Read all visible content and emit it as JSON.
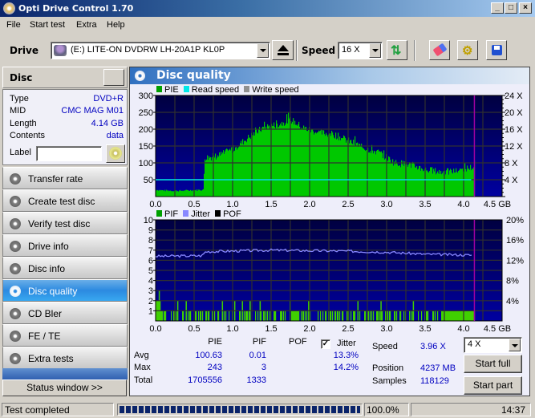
{
  "window": {
    "title": "Opti Drive Control 1.70",
    "min": "_",
    "max": "□",
    "close": "×"
  },
  "menu": [
    "File",
    "Start test",
    "Extra",
    "Help"
  ],
  "toolbar": {
    "drive_label": "Drive",
    "drive_value": "(E:)  LITE-ON DVDRW LH-20A1P KL0P",
    "speed_label": "Speed",
    "speed_value": "16 X"
  },
  "disc": {
    "header": "Disc",
    "rows": [
      {
        "key": "Type",
        "value": "DVD+R"
      },
      {
        "key": "MID",
        "value": "CMC MAG M01"
      },
      {
        "key": "Length",
        "value": "4.14 GB"
      },
      {
        "key": "Contents",
        "value": "data"
      }
    ],
    "label_key": "Label",
    "label_value": ""
  },
  "nav": [
    {
      "label": "Transfer rate",
      "active": false
    },
    {
      "label": "Create test disc",
      "active": false
    },
    {
      "label": "Verify test disc",
      "active": false
    },
    {
      "label": "Drive info",
      "active": false
    },
    {
      "label": "Disc info",
      "active": false
    },
    {
      "label": "Disc quality",
      "active": true
    },
    {
      "label": "CD Bler",
      "active": false
    },
    {
      "label": "FE / TE",
      "active": false
    },
    {
      "label": "Extra tests",
      "active": false
    }
  ],
  "status_window_button": "Status window >>",
  "main_title": "Disc quality",
  "colors": {
    "pie": "#00c800",
    "read": "#00e8e8",
    "write": "#909090",
    "pif": "#00c800",
    "jitter": "#8888ff",
    "pof": "#000000",
    "plot_bg_top": "#000040",
    "plot_bg_bottom": "#0000a0",
    "marker": "#a000a0"
  },
  "chart_data": [
    {
      "type": "bar",
      "title": "PIE / Read speed",
      "legend": [
        "PIE",
        "Read speed",
        "Write speed"
      ],
      "x_ticks": [
        "0.0",
        "0.5",
        "1.0",
        "1.5",
        "2.0",
        "2.5",
        "3.0",
        "3.5",
        "4.0",
        "4.5 GB"
      ],
      "xlim": [
        0,
        4.5
      ],
      "y_ticks": [
        "50",
        "100",
        "150",
        "200",
        "250",
        "300"
      ],
      "ylim": [
        0,
        300
      ],
      "y2_ticks": [
        "4 X",
        "8 X",
        "12 X",
        "16 X",
        "20 X",
        "24 X"
      ],
      "y2lim": [
        0,
        24
      ],
      "disc_end_gb": 4.14,
      "pie_profile": [
        [
          0.0,
          20
        ],
        [
          0.1,
          18
        ],
        [
          0.3,
          17
        ],
        [
          0.5,
          19
        ],
        [
          0.62,
          20
        ],
        [
          0.63,
          115
        ],
        [
          0.8,
          120
        ],
        [
          1.0,
          140
        ],
        [
          1.2,
          175
        ],
        [
          1.4,
          205
        ],
        [
          1.6,
          215
        ],
        [
          1.75,
          228
        ],
        [
          1.9,
          205
        ],
        [
          2.1,
          190
        ],
        [
          2.3,
          185
        ],
        [
          2.5,
          165
        ],
        [
          2.7,
          145
        ],
        [
          2.9,
          130
        ],
        [
          3.1,
          100
        ],
        [
          3.3,
          95
        ],
        [
          3.5,
          80
        ],
        [
          3.7,
          72
        ],
        [
          3.9,
          75
        ],
        [
          4.0,
          82
        ],
        [
          4.14,
          88
        ]
      ],
      "read_speed_x": 4.0
    },
    {
      "type": "bar",
      "title": "PIF / Jitter",
      "legend": [
        "PIF",
        "Jitter",
        "POF"
      ],
      "x_ticks": [
        "0.0",
        "0.5",
        "1.0",
        "1.5",
        "2.0",
        "2.5",
        "3.0",
        "3.5",
        "4.0",
        "4.5 GB"
      ],
      "xlim": [
        0,
        4.5
      ],
      "y_ticks": [
        "1",
        "2",
        "3",
        "4",
        "5",
        "6",
        "7",
        "8",
        "9",
        "10"
      ],
      "ylim": [
        0,
        10
      ],
      "y2_ticks": [
        "4%",
        "8%",
        "12%",
        "16%",
        "20%"
      ],
      "y2lim": [
        0,
        20
      ],
      "disc_end_gb": 4.14,
      "jitter_profile": [
        [
          0.0,
          12.8
        ],
        [
          0.6,
          12.9
        ],
        [
          0.65,
          13.7
        ],
        [
          1.5,
          14.0
        ],
        [
          2.0,
          13.9
        ],
        [
          2.5,
          13.8
        ],
        [
          3.0,
          13.6
        ],
        [
          3.5,
          13.2
        ],
        [
          4.14,
          13.0
        ]
      ],
      "pif_spikes_2": [
        0.02,
        0.05,
        0.28,
        0.39,
        0.86,
        1.02,
        1.12,
        1.22,
        1.35,
        1.74,
        1.98,
        2.62,
        2.92,
        3.34
      ],
      "pif_spike_3": 0.04
    }
  ],
  "stats": {
    "headers": [
      "PIE",
      "PIF",
      "POF",
      "Jitter"
    ],
    "jitter_checked": true,
    "rows": [
      {
        "label": "Avg",
        "pie": "100.63",
        "pif": "0.01",
        "pof": "",
        "jitter": "13.3%"
      },
      {
        "label": "Max",
        "pie": "243",
        "pif": "3",
        "pof": "",
        "jitter": "14.2%"
      },
      {
        "label": "Total",
        "pie": "1705556",
        "pif": "1333",
        "pof": "",
        "jitter": ""
      }
    ],
    "speed_label": "Speed",
    "speed_value": "3.96 X",
    "position_label": "Position",
    "position_value": "4237 MB",
    "samples_label": "Samples",
    "samples_value": "118129",
    "speed_select": "4 X",
    "start_full": "Start full",
    "start_part": "Start part"
  },
  "statusbar": {
    "text": "Test completed",
    "progress": 100,
    "progress_text": "100.0%",
    "time": "14:37"
  }
}
